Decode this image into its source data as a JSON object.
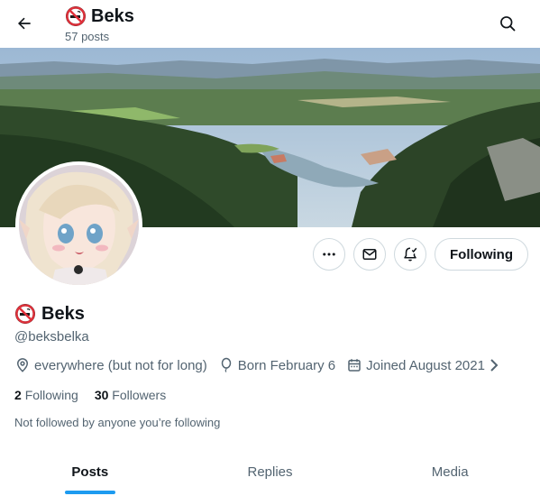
{
  "header": {
    "title": "Beks",
    "posts_count": "57 posts"
  },
  "profile": {
    "display_name": "Beks",
    "handle": "@beksbelka",
    "location": "everywhere (but not for long)",
    "birthday": "Born February 6",
    "joined": "Joined August 2021",
    "following_count": "2",
    "following_label": "Following",
    "followers_count": "30",
    "followers_label": "Followers",
    "followed_note": "Not followed by anyone you’re following"
  },
  "actions": {
    "follow_label": "Following"
  },
  "tabs": [
    {
      "label": "Posts",
      "active": true
    },
    {
      "label": "Replies",
      "active": false
    },
    {
      "label": "Media",
      "active": false
    }
  ],
  "icons": {
    "back": "arrow-left-icon",
    "search": "search-icon",
    "more": "more-icon",
    "message": "envelope-icon",
    "notify": "bell-plus-icon",
    "emoji": "no-smoking-emoji",
    "location": "location-pin-icon",
    "birthday": "balloon-icon",
    "calendar": "calendar-icon"
  },
  "colors": {
    "accent": "#1d9bf0",
    "text": "#0f1419",
    "muted": "#536471",
    "border": "#cfd9de"
  }
}
